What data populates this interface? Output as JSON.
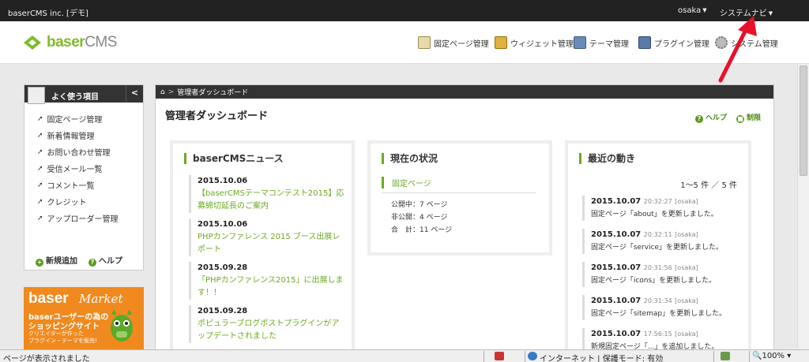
{
  "topbar": {
    "site_name": "baserCMS inc. [デモ]",
    "user_menu": "osaka",
    "system_nav": "システムナビ"
  },
  "header": {
    "logo_text_a": "baser",
    "logo_text_b": "CMS",
    "nav": [
      {
        "label": "固定ページ管理",
        "icon": "page-icon"
      },
      {
        "label": "ウィジェット管理",
        "icon": "widget-icon"
      },
      {
        "label": "テーマ管理",
        "icon": "theme-icon"
      },
      {
        "label": "プラグイン管理",
        "icon": "plugin-icon"
      },
      {
        "label": "システム管理",
        "icon": "gear-icon"
      }
    ]
  },
  "sidebar": {
    "title": "よく使う項目",
    "collapse": "<",
    "items": [
      {
        "label": "固定ページ管理"
      },
      {
        "label": "新着情報管理"
      },
      {
        "label": "お問い合わせ管理"
      },
      {
        "label": "受信メール一覧"
      },
      {
        "label": "コメント一覧"
      },
      {
        "label": "クレジット"
      },
      {
        "label": "アップローダー管理"
      }
    ],
    "add_label": "新規追加",
    "help_label": "ヘルプ"
  },
  "banner": {
    "brand": "baser",
    "brand_script": "Market",
    "line1": "baserユーザーの為の",
    "line2": "ショッピングサイト",
    "line3": "クリエイターが作った",
    "line4": "プラグイン・テーマを販売!"
  },
  "main": {
    "breadcrumb": "管理者ダッシュボード",
    "title": "管理者ダッシュボード",
    "help_link": "ヘルプ",
    "limit_link": "制限"
  },
  "news": {
    "title": "baserCMSニュース",
    "items": [
      {
        "date": "2015.10.06",
        "text": "【baserCMSテーマコンテスト2015】応募締切延長のご案内"
      },
      {
        "date": "2015.10.06",
        "text": "PHPカンファレンス 2015 ブース出展レポート"
      },
      {
        "date": "2015.09.28",
        "text": "「PHPカンファレンス2015」に出展します！！"
      },
      {
        "date": "2015.09.28",
        "text": "ポピュラーブログポストプラグインがアップデートされました"
      }
    ]
  },
  "status": {
    "title": "現在の状況",
    "subtitle": "固定ページ",
    "public": "公開中：7 ページ",
    "private": "非公開：4 ページ",
    "total": "合　計：11 ページ"
  },
  "recent": {
    "title": "最近の動き",
    "pager": "1～5 件 ／ 5 件",
    "items": [
      {
        "date": "2015.10.07",
        "time": "20:32:27",
        "user": "[osaka]",
        "desc": "固定ページ「about」を更新しました。"
      },
      {
        "date": "2015.10.07",
        "time": "20:32:11",
        "user": "[osaka]",
        "desc": "固定ページ「service」を更新しました。"
      },
      {
        "date": "2015.10.07",
        "time": "20:31:56",
        "user": "[osaka]",
        "desc": "固定ページ「icons」を更新しました。"
      },
      {
        "date": "2015.10.07",
        "time": "20:31:34",
        "user": "[osaka]",
        "desc": "固定ページ「sitemap」を更新しました。"
      },
      {
        "date": "2015.10.07",
        "time": "17:56:15",
        "user": "[osaka]",
        "desc": "新規固定ページ「...」を追加しました。"
      }
    ]
  },
  "statusbar": {
    "message": "ページが表示されました",
    "zone": "インターネット | 保護モード: 有効",
    "zoom": "100%"
  },
  "colors": {
    "accent_green": "#6aab1f",
    "dark_bar": "#222222",
    "banner_orange": "#f08a1e",
    "arrow_red": "#e8102a"
  }
}
